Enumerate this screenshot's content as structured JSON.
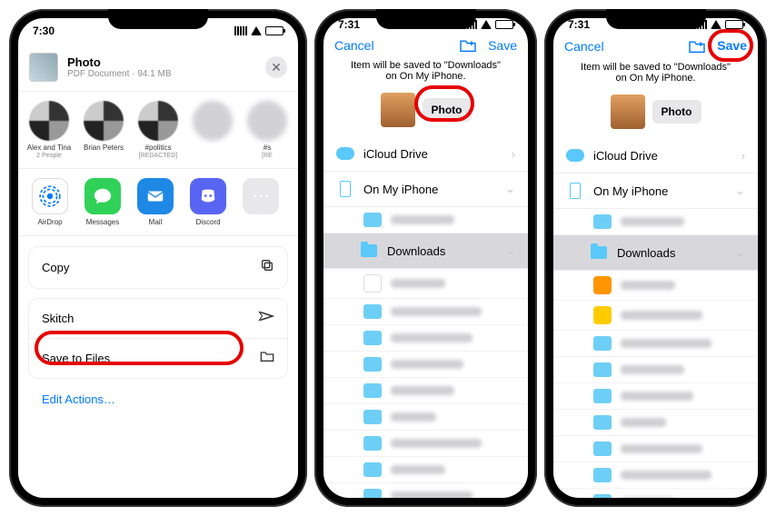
{
  "phone1": {
    "time": "7:30",
    "file": {
      "title": "Photo",
      "subtitle": "PDF Document · 94.1 MB"
    },
    "contacts": [
      {
        "name": "Alex and Tina",
        "sub": "2 People"
      },
      {
        "name": "Brian Peters",
        "sub": ""
      },
      {
        "name": "#politics",
        "sub": "[REDACTED]"
      },
      {
        "name": "",
        "sub": ""
      },
      {
        "name": "#s",
        "sub": "[RE"
      }
    ],
    "apps": {
      "airdrop": "AirDrop",
      "messages": "Messages",
      "mail": "Mail",
      "discord": "Discord"
    },
    "actions": {
      "copy": "Copy",
      "skitch": "Skitch",
      "save_to_files": "Save to Files",
      "edit": "Edit Actions…"
    }
  },
  "phone2": {
    "time": "7:31",
    "cancel": "Cancel",
    "save": "Save",
    "info": "Item will be saved to \"Downloads\" on On My iPhone.",
    "filename": "Photo",
    "locations": {
      "icloud": "iCloud Drive",
      "onmyiphone": "On My iPhone",
      "downloads": "Downloads"
    }
  },
  "phone3": {
    "time": "7:31",
    "cancel": "Cancel",
    "save": "Save",
    "info": "Item will be saved to \"Downloads\" on On My iPhone.",
    "filename": "Photo",
    "locations": {
      "icloud": "iCloud Drive",
      "onmyiphone": "On My iPhone",
      "downloads": "Downloads"
    }
  }
}
